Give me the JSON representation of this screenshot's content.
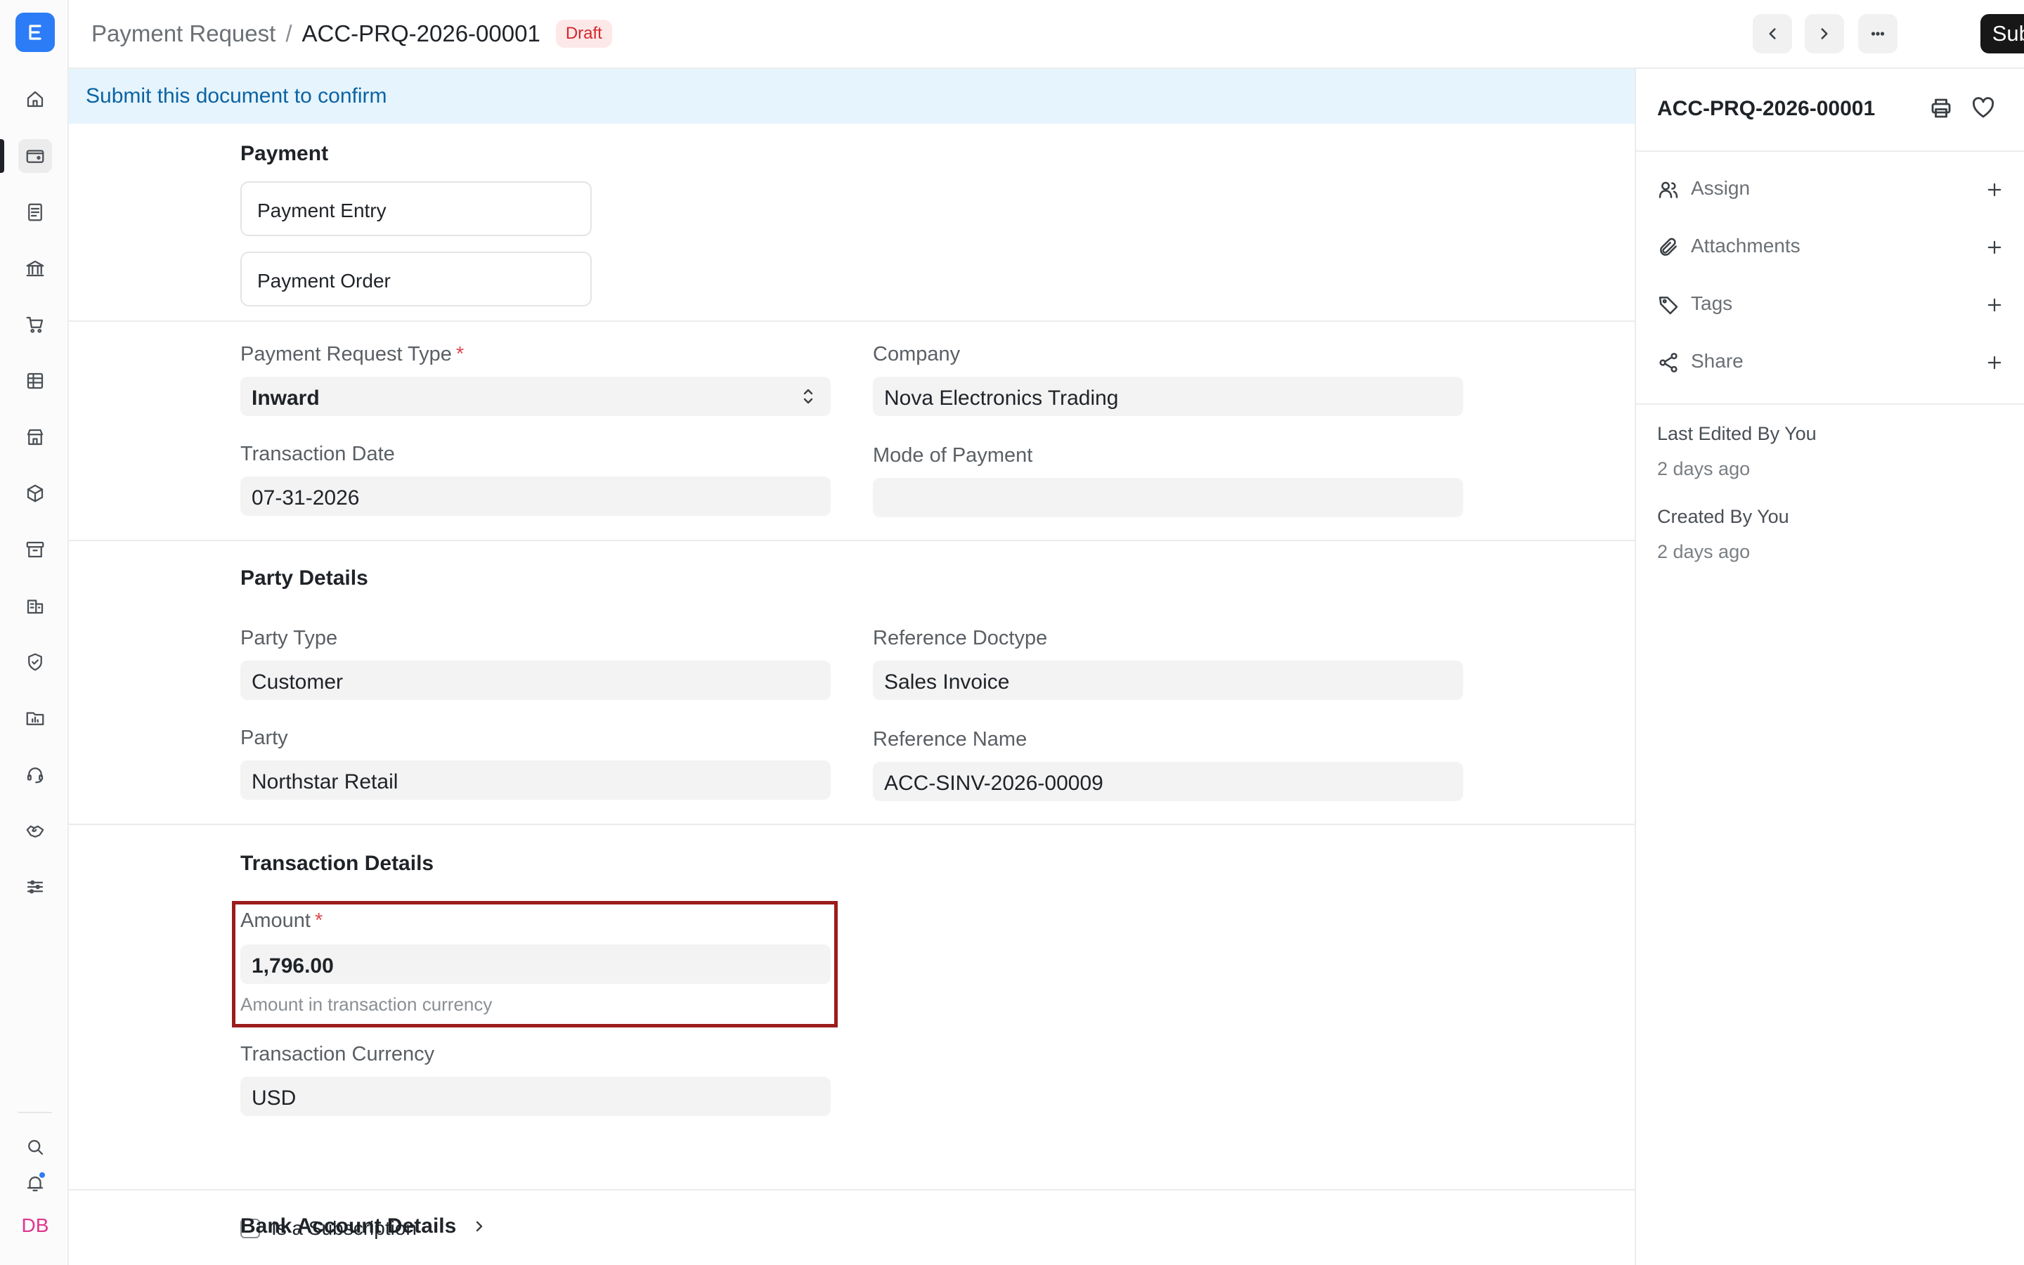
{
  "breadcrumb": {
    "parent": "Payment Request",
    "separator": "/",
    "current": "ACC-PRQ-2026-00001",
    "status": "Draft"
  },
  "header": {
    "submit_label": "Submit"
  },
  "banner": {
    "text": "Submit this document to confirm"
  },
  "payment_section": {
    "title": "Payment",
    "links": [
      "Payment Entry",
      "Payment Order"
    ]
  },
  "fields": {
    "payment_request_type": {
      "label": "Payment Request Type",
      "value": "Inward",
      "required": "*"
    },
    "company": {
      "label": "Company",
      "value": "Nova Electronics Trading"
    },
    "transaction_date": {
      "label": "Transaction Date",
      "value": "07-31-2026"
    },
    "mode_of_payment": {
      "label": "Mode of Payment",
      "value": ""
    }
  },
  "party_section": {
    "title": "Party Details",
    "party_type": {
      "label": "Party Type",
      "value": "Customer"
    },
    "reference_doctype": {
      "label": "Reference Doctype",
      "value": "Sales Invoice"
    },
    "party": {
      "label": "Party",
      "value": "Northstar Retail"
    },
    "reference_name": {
      "label": "Reference Name",
      "value": "ACC-SINV-2026-00009"
    }
  },
  "transaction_section": {
    "title": "Transaction Details",
    "amount": {
      "label": "Amount",
      "required": "*",
      "value": "1,796.00",
      "help": "Amount in transaction currency"
    },
    "currency": {
      "label": "Transaction Currency",
      "value": "USD"
    },
    "is_subscription": {
      "label": "Is a Subscription",
      "checked": false
    }
  },
  "bank_section": {
    "title": "Bank Account Details"
  },
  "right_panel": {
    "doc_name": "ACC-PRQ-2026-00001",
    "actions": [
      "Assign",
      "Attachments",
      "Tags",
      "Share"
    ],
    "last_edited": "Last Edited By You",
    "last_edited_time": "2 days ago",
    "created": "Created By You",
    "created_time": "2 days ago"
  },
  "user": {
    "initials": "DB"
  },
  "colors": {
    "accent": "#2b7cf6",
    "draft_badge_bg": "#fde8e8",
    "draft_badge_text": "#d7262d",
    "banner_bg": "#e6f4fd",
    "banner_text": "#0b63a3",
    "highlight_border": "#9b1c1c",
    "submit_bg": "#171717"
  }
}
